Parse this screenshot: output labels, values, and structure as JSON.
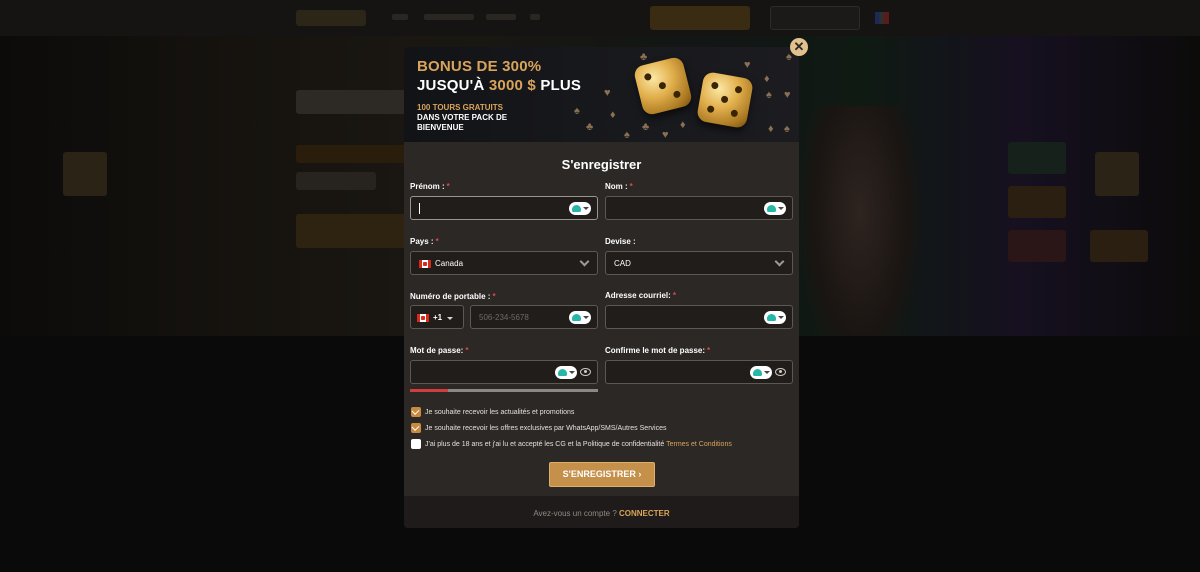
{
  "background": {
    "dimmed": true
  },
  "modal": {
    "close_icon": "close-icon",
    "banner": {
      "bonus_line": "BONUS DE 300%",
      "amount_prefix": "JUSQU'À",
      "amount_value": "3000 $",
      "amount_suffix": "PLUS",
      "tours_line": "100 TOURS GRATUITS",
      "pack_line": "DANS VOTRE PACK DE BIENVENUE",
      "image": "golden-dice"
    },
    "title": "S'enregistrer",
    "fields": {
      "prenom": {
        "label": "Prénom :",
        "required": "*",
        "value": ""
      },
      "nom": {
        "label": "Nom :",
        "required": "*",
        "value": ""
      },
      "pays": {
        "label": "Pays :",
        "required": "*",
        "value": "Canada",
        "flag": "canada-flag"
      },
      "devise": {
        "label": "Devise :",
        "value": "CAD"
      },
      "portable": {
        "label": "Numéro de portable :",
        "required": "*",
        "dial_code": "+1",
        "placeholder": "506-234-5678"
      },
      "courriel": {
        "label": "Adresse courriel:",
        "required": "*",
        "value": ""
      },
      "passe": {
        "label": "Mot de passe:",
        "required": "*",
        "value": "",
        "strength": 0.2
      },
      "confirme": {
        "label": "Confirme le mot de passe:",
        "required": "*",
        "value": ""
      }
    },
    "checkboxes": [
      {
        "label": "Je souhaite recevoir les actualités et promotions",
        "checked": true
      },
      {
        "label": "Je souhaite recevoir les offres exclusives par WhatsApp/SMS/Autres Services",
        "checked": true
      },
      {
        "label": "J'ai plus de 18 ans et j'ai lu et accepté les CG et la Politique de confidentialité",
        "link": "Termes et Conditions",
        "checked": false
      }
    ],
    "submit_label": "S'ENREGISTRER ›",
    "footer": {
      "question": "Avez-vous un compte ?",
      "login_label": "CONNECTER"
    }
  },
  "colors": {
    "accent": "#d9a45a",
    "button": "#c4904a",
    "modal_bg": "#2b2826",
    "field_bg": "#201d1b",
    "required": "#e04848"
  }
}
